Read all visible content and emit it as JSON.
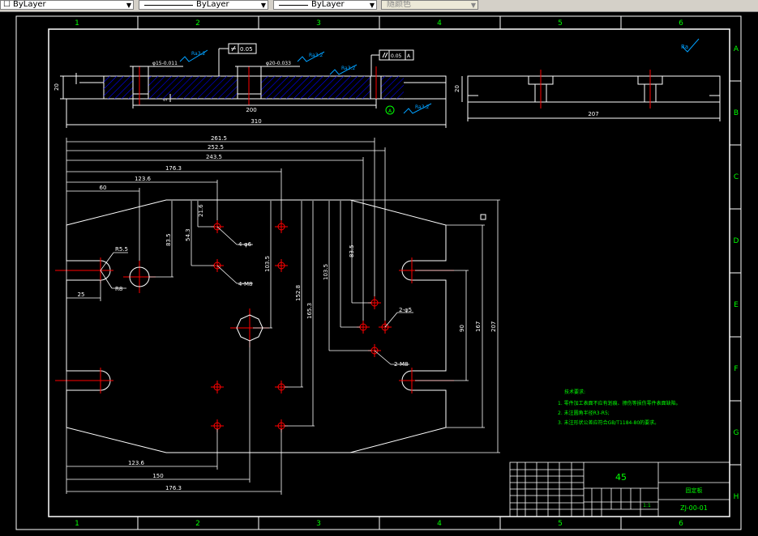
{
  "toolbar": {
    "layer_combo": {
      "value": "ByLayer"
    },
    "linetype_combo": {
      "value": "ByLayer"
    },
    "lineweight_combo": {
      "value": "ByLayer"
    },
    "color_combo": {
      "value": "随颜色"
    }
  },
  "frame": {
    "col_labels": [
      "1",
      "2",
      "3",
      "4",
      "5",
      "6"
    ],
    "row_labels": [
      "A",
      "B",
      "C",
      "D",
      "E",
      "F",
      "G",
      "H"
    ]
  },
  "top_view": {
    "surface_finish_labels": [
      "Ra3.2",
      "Ra3.2",
      "Ra3.2",
      "Ra3.2",
      "Ra3.2"
    ],
    "flatness": "0.05",
    "parallelism": "0.05",
    "datum": "A",
    "hole_left": "φ15-0.011",
    "hole_right": "φ20-0.033",
    "thickness": "20",
    "small_dim": "5",
    "dim_200": "200",
    "dim_310": "310",
    "datum_marker": "A"
  },
  "side_view": {
    "thickness": "20",
    "length": "207"
  },
  "plan_dims": {
    "d_261_5": "261.5",
    "d_252_5": "252.5",
    "d_243_5": "243.5",
    "d_176_3": "176.3",
    "d_123_6_top": "123.6",
    "d_60": "60",
    "d_21_6": "21.6",
    "d_54_3": "54.3",
    "d_83_5_left": "83.5",
    "d_103_5_mid": "103.5",
    "d_152_8": "152.8",
    "d_165_3": "165.3",
    "d_103_5_right": "103.5",
    "d_83_5_right": "83.5",
    "d_90": "90",
    "d_167": "167",
    "d_207": "207",
    "d_25": "25",
    "r_5_5": "R5.5",
    "r_8": "R8",
    "holes_4_phi6": "4-φ6",
    "holes_4_m8": "4-M8",
    "holes_2_phi5": "2-φ5",
    "holes_2_m8": "2-M8",
    "d_123_6_bot": "123.6",
    "d_150": "150",
    "d_176_3_bot": "176.3"
  },
  "tech_notes": {
    "title": "技术要求:",
    "items": [
      "1. 零件加工表面不应有划痕、擦伤等损伤零件表面缺陷。",
      "2. 未注圆角半径R3-R5;",
      "3. 未注形状公差应符合GB/T1184-80的要求。"
    ]
  },
  "title_block": {
    "material": "45",
    "part_name": "固定板",
    "drawing_no": "ZJ-00-01",
    "scale": "1:1"
  },
  "colors": {
    "background": "#000000",
    "frame": "#ffffff",
    "dimension": "#ffffff",
    "centerline": "#ff0000",
    "hatch": "#0000ff",
    "annotation": "#00a0ff",
    "notes": "#00ff00",
    "title_block": "#00ff00",
    "toolbar": "#d4d0c8"
  }
}
